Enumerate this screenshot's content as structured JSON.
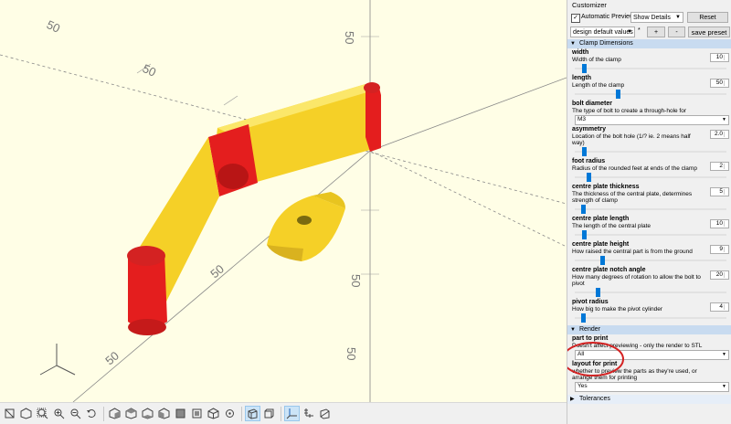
{
  "panel": {
    "title": "Customizer",
    "auto_preview_label": "Automatic Preview",
    "auto_preview_checked": true,
    "details_select": "Show Details",
    "reset_label": "Reset",
    "preset_select": "design default values",
    "preset_star": "*",
    "plus_label": "+",
    "minus_label": "-",
    "save_preset_label": "save preset"
  },
  "sections": {
    "clamp": {
      "title": "Clamp Dimensions",
      "params": [
        {
          "name": "width",
          "desc": "Width of the clamp",
          "value": "10",
          "slider": 0.05
        },
        {
          "name": "length",
          "desc": "Length of the clamp",
          "value": "50",
          "slider": 0.27
        },
        {
          "name": "bolt diameter",
          "desc": "The type of bolt to create a through-hole for",
          "value": "M3"
        },
        {
          "name": "asymmetry",
          "desc": "Location of the bolt hole (1/? ie. 2 means half way)",
          "value": "2.0",
          "slider": 0.05
        },
        {
          "name": "foot radius",
          "desc": "Radius of the rounded feet at ends of the clamp",
          "value": "2",
          "slider": 0.08
        },
        {
          "name": "centre plate thickness",
          "desc": "The thickness of the central plate, determines strength of clamp",
          "value": "5",
          "slider": 0.04
        },
        {
          "name": "centre plate length",
          "desc": "The length of the central plate",
          "value": "10",
          "slider": 0.05
        },
        {
          "name": "centre plate height",
          "desc": "How raised the central part is from the ground",
          "value": "9",
          "slider": 0.17
        },
        {
          "name": "centre plate notch angle",
          "desc": "How many degrees of rotation to allow the bolt to pivot",
          "value": "20",
          "slider": 0.14
        },
        {
          "name": "pivot radius",
          "desc": "How big to make the pivot cylinder",
          "value": "4",
          "slider": 0.04
        }
      ]
    },
    "render": {
      "title": "Render",
      "params": [
        {
          "name": "part to print",
          "desc": "Doesn't affect previewing - only the render to STL",
          "value": "All"
        },
        {
          "name": "layout for print",
          "desc": "whether to preview the parts as they're used, or arrange them for printing",
          "value": "Yes"
        }
      ]
    },
    "tolerances": {
      "title": "Tolerances"
    }
  },
  "viewport": {
    "axis_labels": [
      "50",
      "50",
      "50",
      "50",
      "50",
      "50",
      "50"
    ],
    "colors": {
      "background": "#fffee6",
      "part": "#f5d027",
      "part_dark": "#d9b21f",
      "highlight": "#e41e1e",
      "circle": "#d42222"
    }
  },
  "toolbar": {
    "icons": [
      "render-icon",
      "preview-icon",
      "view-all-icon",
      "zoom-in-icon",
      "zoom-out-icon",
      "reset-view-icon",
      "view-right-icon",
      "view-top-icon",
      "view-bottom-icon",
      "view-left-icon",
      "view-front-icon",
      "view-back-icon",
      "view-diagonal-icon",
      "view-center-icon",
      "perspective-icon",
      "orthogonal-icon",
      "show-axes-icon",
      "show-scale-icon",
      "show-edges-icon"
    ]
  }
}
